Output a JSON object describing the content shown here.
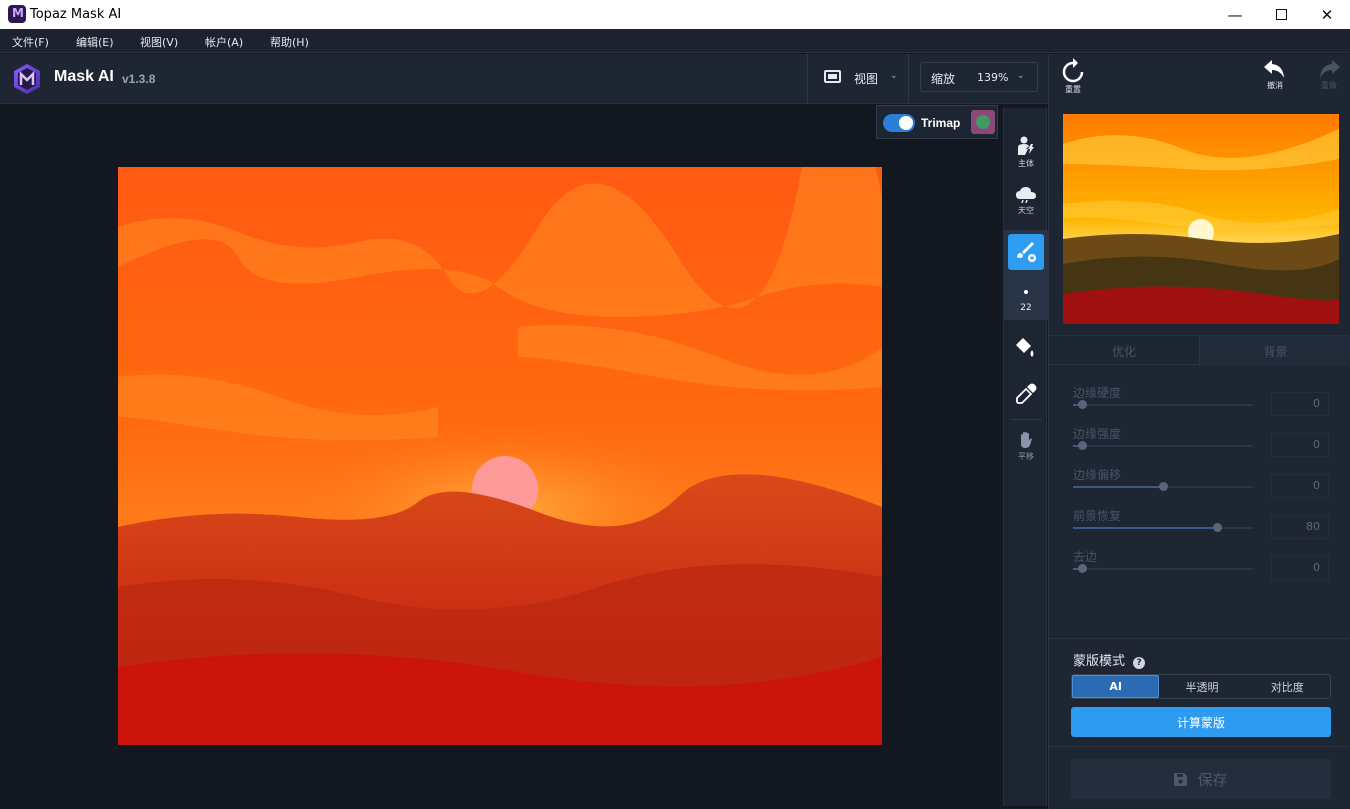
{
  "window": {
    "title": "Topaz Mask AI",
    "logo_letter": "M"
  },
  "menu": [
    "文件(F)",
    "编辑(E)",
    "视图(V)",
    "帐户(A)",
    "帮助(H)"
  ],
  "header": {
    "app_name": "Mask AI",
    "version": "v1.3.8",
    "view_label": "视图",
    "zoom_label": "缩放",
    "zoom_value": "139%"
  },
  "trimap": {
    "label": "Trimap",
    "enabled": true
  },
  "tools": {
    "subject": "主体",
    "sky": "天空",
    "brush_size": "22",
    "pan": "平移"
  },
  "toolbar_right": {
    "reset": "重置",
    "undo": "撤消",
    "redo": "重做"
  },
  "tabs": [
    "优化",
    "背景"
  ],
  "sliders": [
    {
      "name": "边缘硬度",
      "value": "0",
      "level": 0.05
    },
    {
      "name": "边缘强度",
      "value": "0",
      "level": 0.05
    },
    {
      "name": "边缘偏移",
      "value": "0",
      "level": 0.5
    },
    {
      "name": "前景恢复",
      "value": "80",
      "level": 0.8
    },
    {
      "name": "去边",
      "value": "0",
      "level": 0.05
    }
  ],
  "mask_mode": {
    "label": "蒙版模式",
    "options": [
      "AI",
      "半透明",
      "对比度"
    ],
    "selected": "AI"
  },
  "compute_button": "计算蒙版",
  "save_button": "保存",
  "colors": {
    "accent": "#2d9cf0",
    "toggle": "#2b7fd6",
    "brush_tool": "#2e9cf0"
  }
}
